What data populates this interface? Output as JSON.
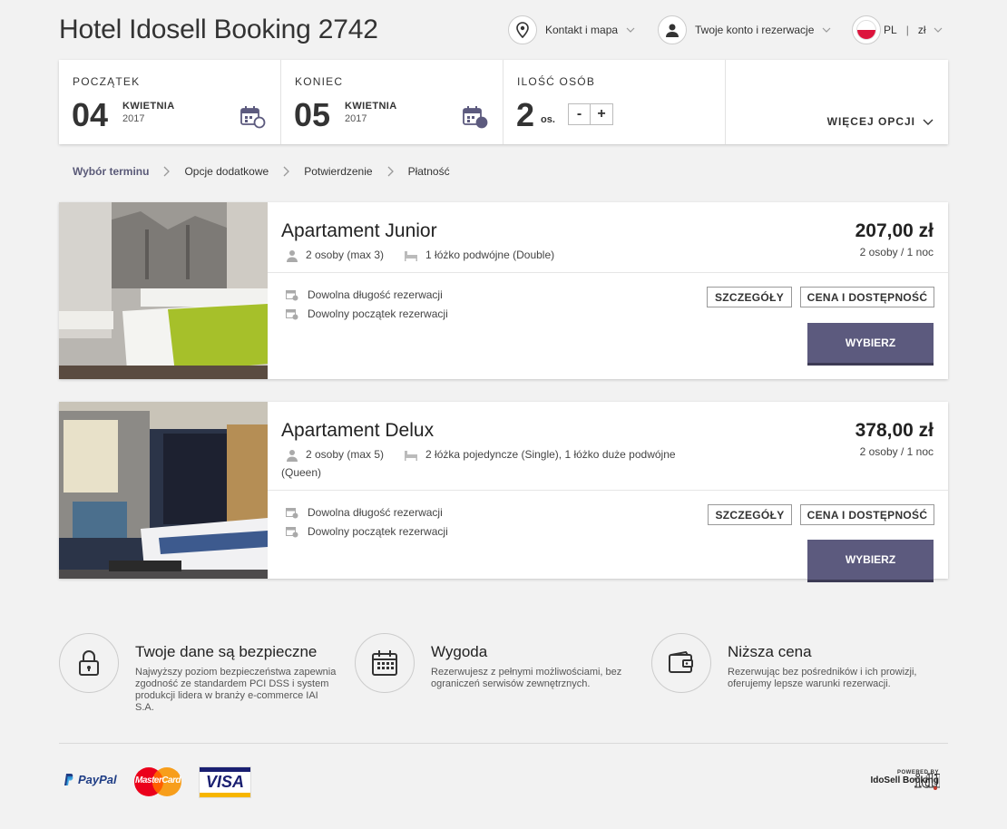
{
  "header": {
    "title": "Hotel Idosell Booking 2742",
    "contact_label": "Kontakt i mapa",
    "account_label": "Twoje konto i rezerwacje",
    "language": "PL",
    "currency": "zł"
  },
  "search": {
    "start": {
      "label": "POCZĄTEK",
      "day": "04",
      "month": "KWIETNIA",
      "year": "2017"
    },
    "end": {
      "label": "KONIEC",
      "day": "05",
      "month": "KWIETNIA",
      "year": "2017"
    },
    "guests": {
      "label": "ILOŚĆ OSÓB",
      "count": "2",
      "unit": "os.",
      "minus": "-",
      "plus": "+"
    },
    "more_options": "WIĘCEJ OPCJI"
  },
  "breadcrumb": [
    "Wybór terminu",
    "Opcje dodatkowe",
    "Potwierdzenie",
    "Płatność"
  ],
  "rooms": [
    {
      "name": "Apartament Junior",
      "persons": "2 osoby (max 3)",
      "beds": "1 łóżko podwójne (Double)",
      "price": "207,00 zł",
      "per": "2 osoby / 1 noc",
      "feature1": "Dowolna długość rezerwacji",
      "feature2": "Dowolny początek rezerwacji",
      "details": "SZCZEGÓŁY",
      "availability": "CENA I DOSTĘPNOŚĆ",
      "choose": "WYBIERZ"
    },
    {
      "name": "Apartament Delux",
      "persons": "2 osoby (max 5)",
      "beds": "2 łóżka pojedyncze (Single), 1 łóżko duże podwójne (Queen)",
      "price": "378,00 zł",
      "per": "2 osoby / 1 noc",
      "feature1": "Dowolna długość rezerwacji",
      "feature2": "Dowolny początek rezerwacji",
      "details": "SZCZEGÓŁY",
      "availability": "CENA I DOSTĘPNOŚĆ",
      "choose": "WYBIERZ"
    }
  ],
  "benefits": [
    {
      "title": "Twoje dane są bezpieczne",
      "desc": "Najwyższy poziom bezpieczeństwa zapewnia zgodność ze standardem PCI DSS i system produkcji lidera w branży e-commerce IAI S.A.",
      "icon": "lock-icon"
    },
    {
      "title": "Wygoda",
      "desc": "Rezerwujesz z pełnymi możliwościami, bez ograniczeń serwisów zewnętrznych.",
      "icon": "calendar-icon"
    },
    {
      "title": "Niższa cena",
      "desc": "Rezerwując bez pośredników i ich prowizji, oferujemy lepsze warunki rezerwacji.",
      "icon": "wallet-icon"
    }
  ],
  "footer": {
    "paypal": "PayPal",
    "mastercard": "MasterCard",
    "visa": "VISA",
    "powered_by": "POWERED BY",
    "powered_brand": "IdoSell Booking"
  },
  "colors": {
    "primary": "#5c5a7e",
    "primary_dark": "#3d3b55",
    "background": "#f2f2f2"
  }
}
